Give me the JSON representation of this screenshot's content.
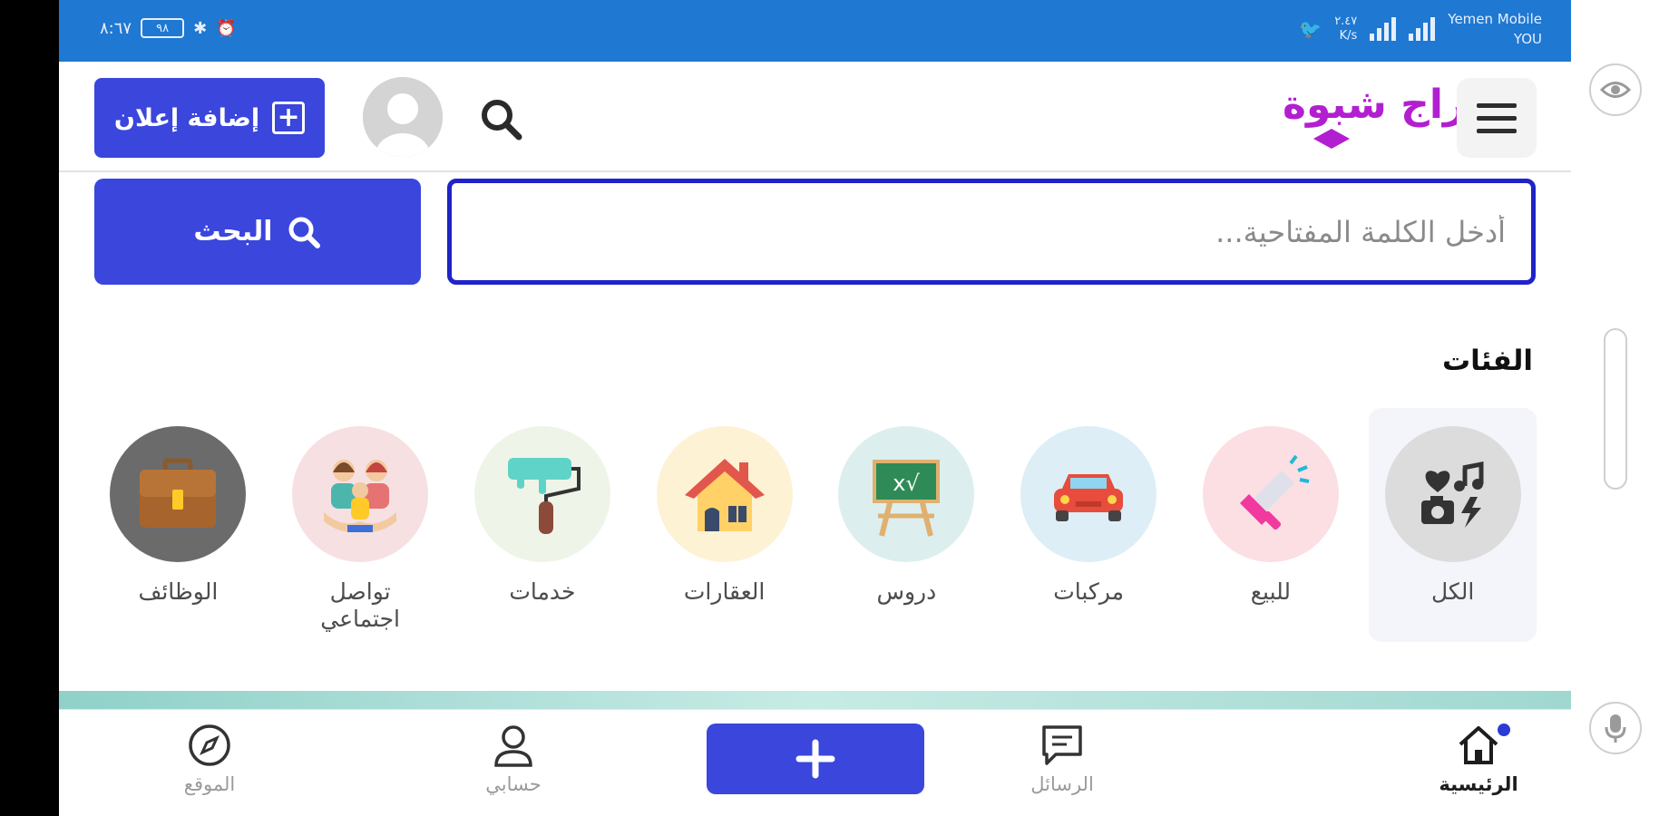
{
  "status_bar": {
    "time": "٨:٦٧",
    "battery": "٩٨",
    "carrier_line1": "Yemen Mobile",
    "carrier_line2": "YOU",
    "speed_value": "٢.٤٧",
    "speed_unit": "K/s"
  },
  "header": {
    "logo_text": "حراج شبوة",
    "add_ad_label": "إضافة إعلان",
    "add_ad_icon": "plus-square-icon",
    "menu_icon": "hamburger-icon",
    "search_icon": "search-icon",
    "avatar_icon": "user-avatar-icon"
  },
  "search": {
    "placeholder": "أدخل الكلمة المفتاحية...",
    "value": "",
    "button_label": "البحث"
  },
  "categories": {
    "title": "الفئات",
    "items": [
      {
        "label": "الكل",
        "icon": "all-media-icon",
        "active": true
      },
      {
        "label": "للبيع",
        "icon": "megaphone-icon",
        "active": false
      },
      {
        "label": "مركبات",
        "icon": "car-icon",
        "active": false
      },
      {
        "label": "دروس",
        "icon": "chalkboard-icon",
        "active": false
      },
      {
        "label": "العقارات",
        "icon": "house-icon",
        "active": false
      },
      {
        "label": "خدمات",
        "icon": "paint-roller-icon",
        "active": false
      },
      {
        "label": "تواصل اجتماعي",
        "icon": "people-hands-icon",
        "active": false
      },
      {
        "label": "الوظائف",
        "icon": "briefcase-icon",
        "active": false
      }
    ]
  },
  "bottom_nav": {
    "home_label": "الرئيسية",
    "messages_label": "الرسائل",
    "account_label": "حسابي",
    "location_label": "الموقع",
    "add_icon": "plus-icon"
  },
  "colors": {
    "primary": "#3a46dc",
    "status_bar": "#1f78d1",
    "logo": "#b21fd0",
    "input_border": "#1f23c8"
  }
}
